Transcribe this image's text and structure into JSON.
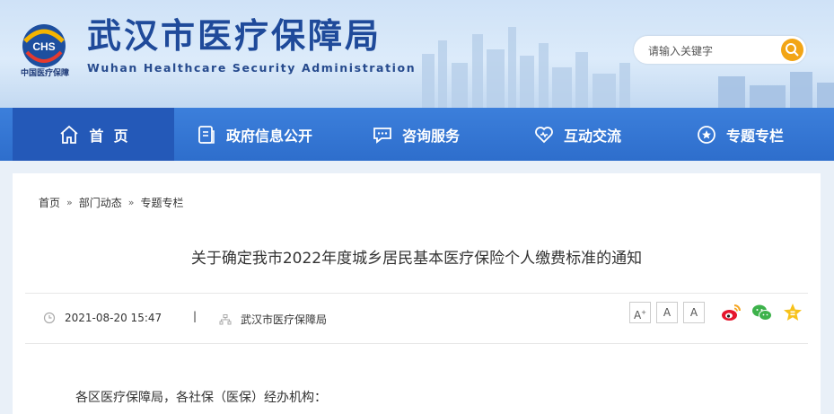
{
  "header": {
    "title": "武汉市医疗保障局",
    "subtitle": "Wuhan Healthcare Security Administration",
    "logo_text": "CHS",
    "logo_caption": "中国医疗保障",
    "search_placeholder": "请输入关键字"
  },
  "nav": [
    {
      "label": "首  页",
      "icon": "home-icon",
      "active": true
    },
    {
      "label": "政府信息公开",
      "icon": "document-icon"
    },
    {
      "label": "咨询服务",
      "icon": "chat-icon"
    },
    {
      "label": "互动交流",
      "icon": "heart-icon"
    },
    {
      "label": "专题专栏",
      "icon": "star-icon"
    }
  ],
  "breadcrumb": [
    "首页",
    "部门动态",
    "专题专栏"
  ],
  "breadcrumb_sep": "»",
  "article": {
    "title": "关于确定我市2022年度城乡居民基本医疗保险个人缴费标准的通知",
    "date": "2021-08-20 15:47",
    "divider": "|",
    "source": "武汉市医疗保障局",
    "greeting": "各区医疗保障局，各社保（医保）经办机构："
  },
  "font_sizes": [
    "A",
    "A",
    "A"
  ],
  "share": [
    "weibo-icon",
    "wechat-icon",
    "favorite-icon"
  ],
  "colors": {
    "brand": "#1f4a9a",
    "nav": "#3374d4",
    "search_button": "#f2a516"
  }
}
